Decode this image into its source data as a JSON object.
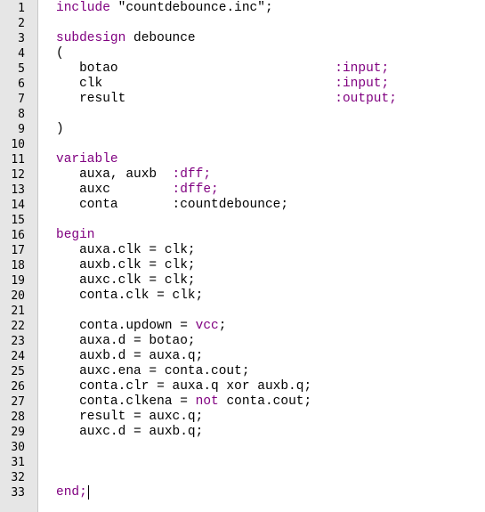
{
  "editor": {
    "keyword_color": "#800080",
    "text_color": "#000000",
    "gutter_color": "#e6e6e6",
    "line_numbers": [
      "1",
      "2",
      "3",
      "4",
      "5",
      "6",
      "7",
      "8",
      "9",
      "10",
      "11",
      "12",
      "13",
      "14",
      "15",
      "16",
      "17",
      "18",
      "19",
      "20",
      "21",
      "22",
      "23",
      "24",
      "25",
      "26",
      "27",
      "28",
      "29",
      "30",
      "31",
      "32",
      "33"
    ],
    "fold_icon": "minus-box-icon",
    "lines": [
      [
        {
          "t": "include ",
          "k": 1
        },
        {
          "t": "\"countdebounce.inc\";",
          "k": 0
        }
      ],
      [],
      [
        {
          "t": "subdesign ",
          "k": 1
        },
        {
          "t": "debounce",
          "k": 0
        }
      ],
      [
        {
          "t": "(",
          "k": 0
        }
      ],
      [
        {
          "t": "   botao",
          "k": 0
        },
        {
          "t": "                            ",
          "k": 0
        },
        {
          "t": ":input;",
          "k": 1
        }
      ],
      [
        {
          "t": "   clk",
          "k": 0
        },
        {
          "t": "                              ",
          "k": 0
        },
        {
          "t": ":input;",
          "k": 1
        }
      ],
      [
        {
          "t": "   result",
          "k": 0
        },
        {
          "t": "                           ",
          "k": 0
        },
        {
          "t": ":output;",
          "k": 1
        }
      ],
      [],
      [
        {
          "t": ")",
          "k": 0
        }
      ],
      [],
      [
        {
          "t": "variable",
          "k": 1
        }
      ],
      [
        {
          "t": "   auxa, auxb  ",
          "k": 0
        },
        {
          "t": ":dff;",
          "k": 1
        }
      ],
      [
        {
          "t": "   auxc        ",
          "k": 0
        },
        {
          "t": ":dffe;",
          "k": 1
        }
      ],
      [
        {
          "t": "   conta       :countdebounce;",
          "k": 0
        }
      ],
      [],
      [
        {
          "t": "begin",
          "k": 1
        }
      ],
      [
        {
          "t": "   auxa.clk = clk;",
          "k": 0
        }
      ],
      [
        {
          "t": "   auxb.clk = clk;",
          "k": 0
        }
      ],
      [
        {
          "t": "   auxc.clk = clk;",
          "k": 0
        }
      ],
      [
        {
          "t": "   conta.clk = clk;",
          "k": 0
        }
      ],
      [],
      [
        {
          "t": "   conta.updown = ",
          "k": 0
        },
        {
          "t": "vcc",
          "k": 1
        },
        {
          "t": ";",
          "k": 0
        }
      ],
      [
        {
          "t": "   auxa.d = botao;",
          "k": 0
        }
      ],
      [
        {
          "t": "   auxb.d = auxa.q;",
          "k": 0
        }
      ],
      [
        {
          "t": "   auxc.ena = conta.cout;",
          "k": 0
        }
      ],
      [
        {
          "t": "   conta.clr = auxa.q xor auxb.q;",
          "k": 0
        }
      ],
      [
        {
          "t": "   conta.clkena = ",
          "k": 0
        },
        {
          "t": "not",
          "k": 1
        },
        {
          "t": " conta.cout;",
          "k": 0
        }
      ],
      [
        {
          "t": "   result = auxc.q;",
          "k": 0
        }
      ],
      [
        {
          "t": "   auxc.d = auxb.q;",
          "k": 0
        }
      ],
      [],
      [],
      [],
      [
        {
          "t": "end;",
          "k": 1
        }
      ]
    ]
  }
}
